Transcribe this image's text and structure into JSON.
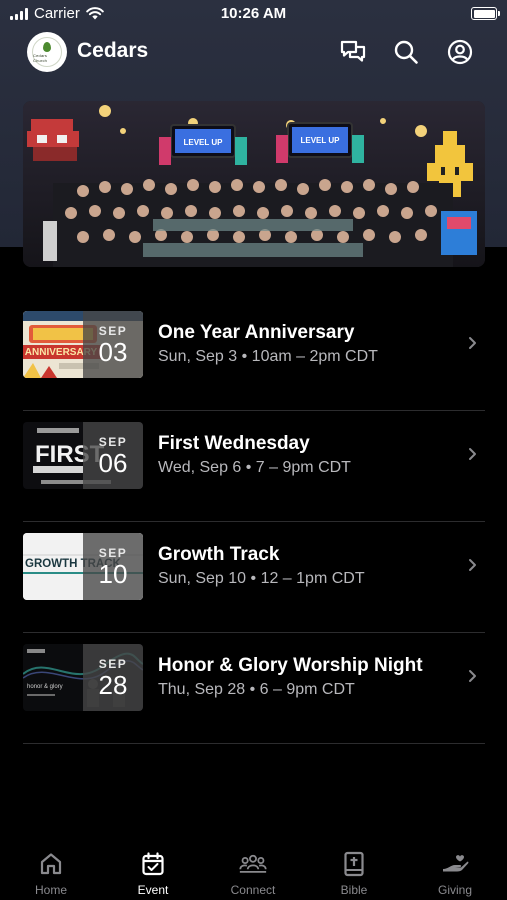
{
  "status_bar": {
    "carrier": "Carrier",
    "time": "10:26 AM"
  },
  "header": {
    "title": "Cedars",
    "logo_text": "Cedars Church"
  },
  "hero": {
    "banner_text": "LEVEL UP"
  },
  "events": [
    {
      "title": "One Year Anniversary",
      "subtitle": "Sun, Sep 3 • 10am – 2pm CDT",
      "month": "SEP",
      "day": "03",
      "thumb_text": "ANNIVERSARY"
    },
    {
      "title": "First Wednesday",
      "subtitle": "Wed, Sep 6 • 7 – 9pm CDT",
      "month": "SEP",
      "day": "06",
      "thumb_text": "FIRST"
    },
    {
      "title": "Growth Track",
      "subtitle": "Sun, Sep 10 • 12 – 1pm CDT",
      "month": "SEP",
      "day": "10",
      "thumb_text": "GROWTH TRACK"
    },
    {
      "title": "Honor & Glory Worship Night",
      "subtitle": "Thu, Sep 28 • 6 – 9pm CDT",
      "month": "SEP",
      "day": "28",
      "thumb_text": "honor & glory"
    }
  ],
  "tabs": [
    {
      "label": "Home",
      "icon": "home-icon",
      "active": false
    },
    {
      "label": "Event",
      "icon": "calendar-icon",
      "active": true
    },
    {
      "label": "Connect",
      "icon": "people-icon",
      "active": false
    },
    {
      "label": "Bible",
      "icon": "bible-icon",
      "active": false
    },
    {
      "label": "Giving",
      "icon": "giving-hand-icon",
      "active": false
    }
  ],
  "colors": {
    "background": "#000000",
    "header_bg": "#2b3040",
    "tab_active": "#ffffff",
    "tab_inactive": "#8a8a8e",
    "subtitle": "#b8b8bc"
  }
}
